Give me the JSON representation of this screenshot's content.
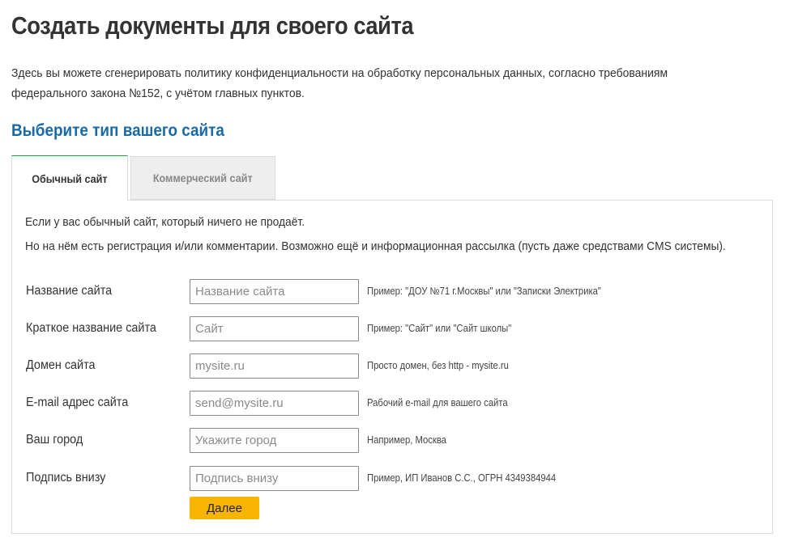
{
  "page": {
    "title": "Создать документы для своего сайта",
    "intro_line1": "Здесь вы можете сгенерировать политику конфиденциальности на обработку персональных данных, согласно требованиям",
    "intro_line2": "федерального закона №152, с учётом главных пунктов."
  },
  "section": {
    "title": "Выберите тип вашего сайта"
  },
  "tabs": [
    {
      "label": "Обычный сайт",
      "active": true
    },
    {
      "label": "Коммерческий сайт",
      "active": false
    }
  ],
  "panel": {
    "description_line1": "Если у вас обычный сайт, который ничего не продаёт.",
    "description_line2": "Но на нём есть регистрация и/или комментарии. Возможно ещё и информационная рассылка (пусть даже средствами CMS системы).",
    "fields": [
      {
        "label": "Название сайта",
        "placeholder": "Название сайта",
        "value": "",
        "hint": "Пример: \"ДОУ №71 г.Москвы\" или \"Записки Электрика\""
      },
      {
        "label": "Краткое название сайта",
        "placeholder": "Сайт",
        "value": "",
        "hint": "Пример: \"Сайт\" или \"Сайт школы\""
      },
      {
        "label": "Домен сайта",
        "placeholder": "mysite.ru",
        "value": "",
        "hint": "Просто домен, без http - mysite.ru"
      },
      {
        "label": "E-mail адрес сайта",
        "placeholder": "send@mysite.ru",
        "value": "",
        "hint": "Рабочий e-mail для вашего сайта"
      },
      {
        "label": "Ваш город",
        "placeholder": "Укажите город",
        "value": "",
        "hint": "Например, Москва"
      },
      {
        "label": "Подпись внизу",
        "placeholder": "Подпись внизу",
        "value": "",
        "hint": "Пример, ИП Иванов С.С., ОГРН 4349384944"
      }
    ],
    "submit_label": "Далее"
  },
  "colors": {
    "heading": "#333333",
    "section_title": "#1a6aa8",
    "active_tab_top_border": "#27a24a",
    "inactive_tab_bg": "#eeeeee",
    "submit_bg": "#f7b500"
  }
}
